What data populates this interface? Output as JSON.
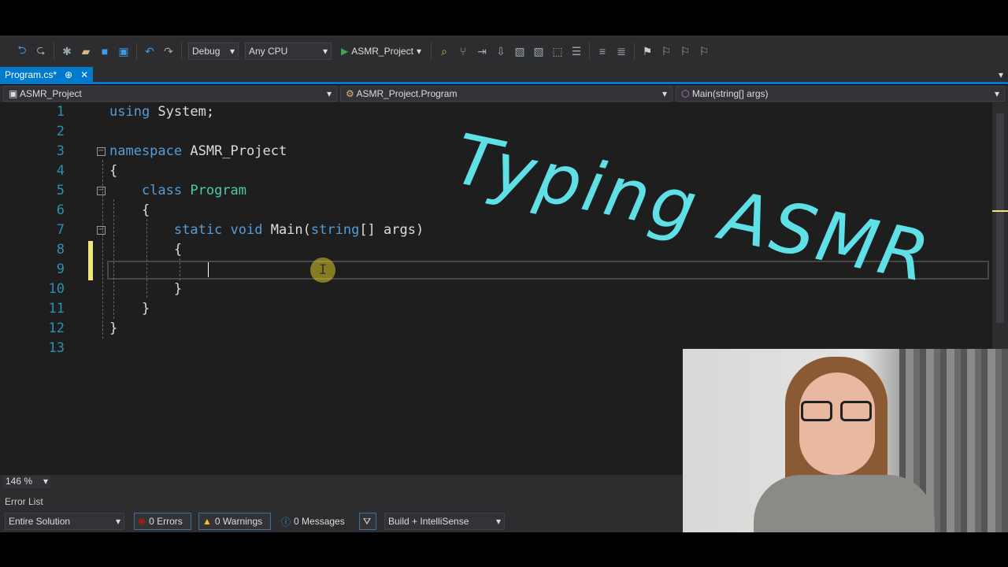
{
  "toolbar": {
    "config": "Debug",
    "platform": "Any CPU",
    "start": "ASMR_Project"
  },
  "tab": {
    "label": "Program.cs*",
    "pin": "⊕",
    "close": "✕"
  },
  "nav": {
    "project": "ASMR_Project",
    "class": "ASMR_Project.Program",
    "member": "Main(string[] args)"
  },
  "editor": {
    "lines": [
      "1",
      "2",
      "3",
      "4",
      "5",
      "6",
      "7",
      "8",
      "9",
      "10",
      "11",
      "12",
      "13"
    ],
    "code": {
      "l1a": "using",
      "l1b": " System;",
      "l3a": "namespace",
      "l3b": " ASMR_Project",
      "l4": "{",
      "l5a": "    class",
      "l5b": " Program",
      "l6": "    {",
      "l7a": "        static void",
      "l7b": " Main(",
      "l7c": "string",
      "l7d": "[] args)",
      "l8": "        {",
      "l10": "        }",
      "l11": "    }",
      "l12": "}"
    }
  },
  "overlay": {
    "title": "Typing ASMR"
  },
  "zoom": {
    "value": "146 %"
  },
  "error_list": {
    "title": "Error List",
    "scope": "Entire Solution",
    "errors": "0 Errors",
    "warnings": "0 Warnings",
    "messages": "0 Messages",
    "source": "Build + IntelliSense"
  },
  "colors": {
    "accent": "#007acc",
    "overlay": "#5fe0e6"
  }
}
